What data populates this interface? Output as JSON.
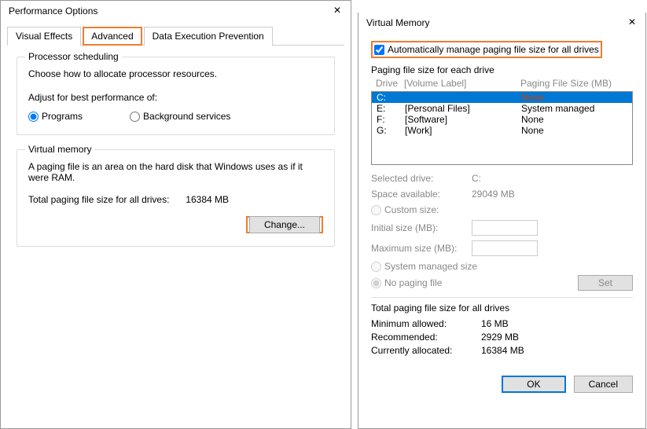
{
  "perfDialog": {
    "title": "Performance Options",
    "tabs": [
      "Visual Effects",
      "Advanced",
      "Data Execution Prevention"
    ],
    "procGroup": {
      "label": "Processor scheduling",
      "desc": "Choose how to allocate processor resources.",
      "adjust": "Adjust for best performance of:",
      "radioPrograms": "Programs",
      "radioBackground": "Background services"
    },
    "vmGroup": {
      "label": "Virtual memory",
      "desc": "A paging file is an area on the hard disk that Windows uses as if it were RAM.",
      "totalLabel": "Total paging file size for all drives:",
      "totalValue": "16384 MB",
      "changeBtn": "Change..."
    }
  },
  "vmDialog": {
    "title": "Virtual Memory",
    "autoCheck": "Automatically manage paging file size for all drives",
    "eachLabel": "Paging file size for each drive",
    "header": {
      "col1": "Drive",
      "col2": "[Volume Label]",
      "col3": "Paging File Size (MB)"
    },
    "drives": [
      {
        "letter": "C:",
        "label": "",
        "size": "None",
        "selected": true
      },
      {
        "letter": "E:",
        "label": "[Personal Files]",
        "size": "System managed",
        "selected": false
      },
      {
        "letter": "F:",
        "label": "[Software]",
        "size": "None",
        "selected": false
      },
      {
        "letter": "G:",
        "label": "[Work]",
        "size": "None",
        "selected": false
      }
    ],
    "selectedDriveLabel": "Selected drive:",
    "selectedDriveValue": "C:",
    "spaceLabel": "Space available:",
    "spaceValue": "29049 MB",
    "customSize": "Custom size:",
    "initialSize": "Initial size (MB):",
    "maxSize": "Maximum size (MB):",
    "sysManaged": "System managed size",
    "noPaging": "No paging file",
    "setBtn": "Set",
    "totalsLabel": "Total paging file size for all drives",
    "minLabel": "Minimum allowed:",
    "minValue": "16 MB",
    "recLabel": "Recommended:",
    "recValue": "2929 MB",
    "curLabel": "Currently allocated:",
    "curValue": "16384 MB",
    "okBtn": "OK",
    "cancelBtn": "Cancel"
  }
}
